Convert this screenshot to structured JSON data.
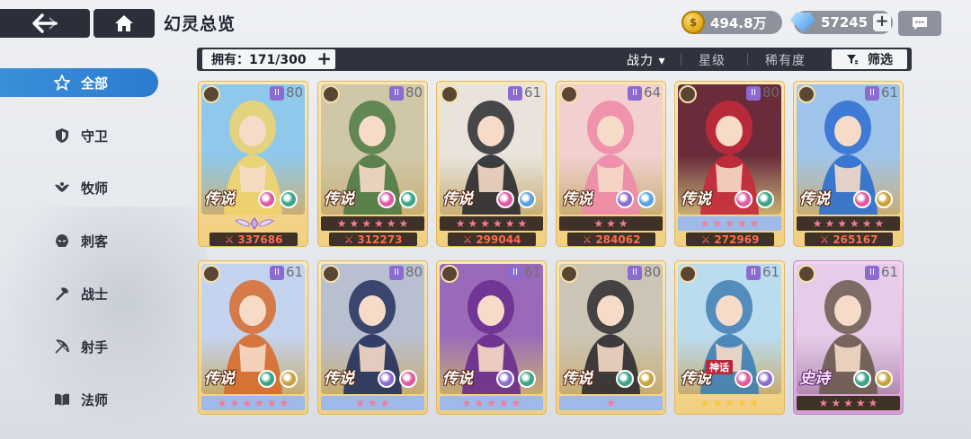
{
  "header": {
    "title": "幻灵总览",
    "gold": "494.8万",
    "gems": "57245",
    "plus_symbol": "+"
  },
  "filterbar": {
    "owned_label": "拥有：171/300",
    "plus_symbol": "+",
    "sort_power": "战力",
    "sort_power_arrow": "▾",
    "sort_star": "星级",
    "sort_rarity": "稀有度",
    "filter_label": "筛选"
  },
  "sidebar": {
    "items": [
      {
        "label": "全部",
        "icon": "star-outline-icon",
        "active": true
      },
      {
        "label": "守卫",
        "icon": "shield-icon",
        "active": false
      },
      {
        "label": "牧师",
        "icon": "wings-icon",
        "active": false
      },
      {
        "label": "刺客",
        "icon": "mask-icon",
        "active": false
      },
      {
        "label": "战士",
        "icon": "axe-icon",
        "active": false
      },
      {
        "label": "射手",
        "icon": "bow-icon",
        "active": false
      },
      {
        "label": "法师",
        "icon": "book-icon",
        "active": false
      }
    ]
  },
  "cards": [
    {
      "level": "80",
      "rarity": "传说",
      "power": "337686",
      "stars": 0,
      "star_style": "wing",
      "faction": "axe-icon",
      "bg": "#8fc8ea",
      "fg": "#f3d46b",
      "elems": [
        "#e05aa0",
        "#39a487"
      ]
    },
    {
      "level": "80",
      "rarity": "传说",
      "power": "312273",
      "stars": 6,
      "star_style": "plain",
      "faction": "shield-icon",
      "bg": "#cfc7a8",
      "fg": "#4f7a45",
      "elems": [
        "#e05aa0",
        "#39a487"
      ]
    },
    {
      "level": "61",
      "rarity": "传说",
      "power": "299044",
      "stars": 6,
      "star_style": "plain",
      "faction": "axe-icon",
      "bg": "#e9e3dc",
      "fg": "#2a2a2e",
      "elems": [
        "#e05aa0",
        "#5aa0e0"
      ]
    },
    {
      "level": "64",
      "rarity": "传说",
      "power": "284062",
      "stars": 3,
      "star_style": "plain",
      "faction": "axe-icon",
      "bg": "#f1d0cf",
      "fg": "#f08aa8",
      "elems": [
        "#8a6bd0",
        "#5aa0e0"
      ]
    },
    {
      "level": "80",
      "rarity": "传说",
      "power": "272969",
      "stars": 5,
      "star_style": "blue",
      "faction": "axe-icon",
      "bg": "#6a2c3a",
      "fg": "#c52a3a",
      "elems": [
        "#e05aa0",
        "#39a487"
      ]
    },
    {
      "level": "61",
      "rarity": "传说",
      "power": "265167",
      "stars": 6,
      "star_style": "plain",
      "faction": "book-icon",
      "bg": "#9fc4ea",
      "fg": "#2e6fd0",
      "elems": [
        "#e05aa0",
        "#c9a23a"
      ]
    },
    {
      "level": "61",
      "rarity": "传说",
      "power": "",
      "stars": 6,
      "star_style": "blue",
      "faction": "mask-icon",
      "bg": "#c4d3ee",
      "fg": "#d76b2c",
      "elems": [
        "#39a487",
        "#c9a23a"
      ]
    },
    {
      "level": "80",
      "rarity": "传说",
      "power": "",
      "stars": 3,
      "star_style": "blue",
      "faction": "bow-icon",
      "bg": "#b8bfd0",
      "fg": "#23305c",
      "elems": [
        "#8a6bd0",
        "#e05aa0"
      ]
    },
    {
      "level": "61",
      "rarity": "传说",
      "power": "",
      "stars": 5,
      "star_style": "blue",
      "faction": "bow-icon",
      "bg": "#9a6ab8",
      "fg": "#6a2c8e",
      "elems": [
        "#8a6bd0",
        "#39a487"
      ]
    },
    {
      "level": "80",
      "rarity": "传说",
      "power": "",
      "stars": 1,
      "star_style": "blue",
      "faction": "axe-icon",
      "bg": "#ccc4b5",
      "fg": "#2d2b30",
      "elems": [
        "#39a487",
        "#c9a23a"
      ]
    },
    {
      "level": "61",
      "rarity": "传说",
      "power": "",
      "stars": 5,
      "star_style": "gold",
      "faction": "book-icon",
      "bg": "#b9dcef",
      "fg": "#3f7fb5",
      "elems": [
        "#e05aa0",
        "#8a6bd0"
      ],
      "mythic": "神话"
    },
    {
      "level": "61",
      "rarity": "史诗",
      "power": "",
      "stars": 5,
      "star_style": "plain",
      "faction": "bow-icon",
      "bg": "#e6cce8",
      "fg": "#6a5a4e",
      "elems": [
        "#39a487",
        "#c9a23a"
      ],
      "epic": true
    }
  ]
}
